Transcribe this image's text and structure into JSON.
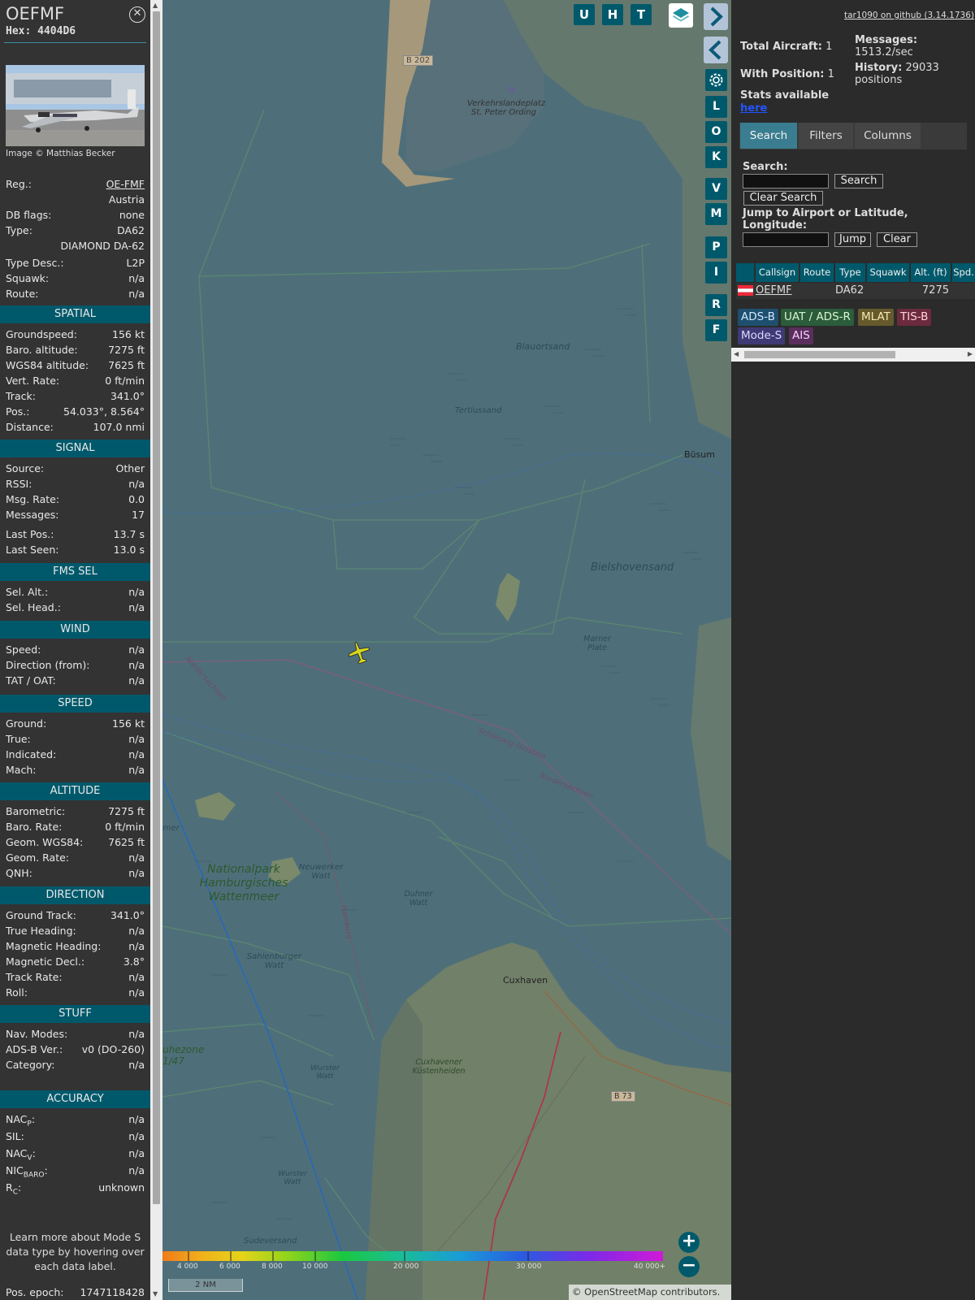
{
  "info_panel": {
    "callsign": "OEFMF",
    "hex_label": "Hex:",
    "hex": "4404D6",
    "close_icon": "close-circle-icon",
    "photo_caption": "Image © Matthias Becker",
    "rows": [
      {
        "k": "Reg.:",
        "v": "OE-FMF",
        "link": true
      },
      {
        "k": "",
        "v": "Austria"
      },
      {
        "k": "DB flags:",
        "v": "none"
      },
      {
        "k": "Type:",
        "v": "DA62"
      },
      {
        "k": "",
        "v": "DIAMOND DA-62"
      },
      {
        "k": "Type Desc.:",
        "v": "L2P"
      },
      {
        "k": "Squawk:",
        "v": "n/a"
      },
      {
        "k": "Route:",
        "v": "n/a"
      }
    ],
    "sections": [
      {
        "title": "SPATIAL",
        "rows": [
          {
            "k": "Groundspeed:",
            "v": "156 kt"
          },
          {
            "k": "Baro. altitude:",
            "v": "7275 ft"
          },
          {
            "k": "WGS84 altitude:",
            "v": "7625 ft"
          },
          {
            "k": "Vert. Rate:",
            "v": "0 ft/min"
          },
          {
            "k": "Track:",
            "v": "341.0°"
          },
          {
            "k": "Pos.:",
            "v": "54.033°, 8.564°"
          },
          {
            "k": "Distance:",
            "v": "107.0 nmi"
          }
        ]
      },
      {
        "title": "SIGNAL",
        "rows": [
          {
            "k": "Source:",
            "v": "Other"
          },
          {
            "k": "RSSI:",
            "v": "n/a"
          },
          {
            "k": "Msg. Rate:",
            "v": "0.0"
          },
          {
            "k": "Messages:",
            "v": "17"
          },
          {
            "k": "Last Pos.:",
            "v": "13.7 s"
          },
          {
            "k": "Last Seen:",
            "v": "13.0 s"
          }
        ]
      },
      {
        "title": "FMS SEL",
        "rows": [
          {
            "k": "Sel. Alt.:",
            "v": "n/a"
          },
          {
            "k": "Sel. Head.:",
            "v": "n/a"
          }
        ]
      },
      {
        "title": "WIND",
        "rows": [
          {
            "k": "Speed:",
            "v": "n/a"
          },
          {
            "k": "Direction (from):",
            "v": "n/a"
          },
          {
            "k": "TAT / OAT:",
            "v": "n/a"
          }
        ]
      },
      {
        "title": "SPEED",
        "rows": [
          {
            "k": "Ground:",
            "v": "156 kt"
          },
          {
            "k": "True:",
            "v": "n/a"
          },
          {
            "k": "Indicated:",
            "v": "n/a"
          },
          {
            "k": "Mach:",
            "v": "n/a"
          }
        ]
      },
      {
        "title": "ALTITUDE",
        "rows": [
          {
            "k": "Barometric:",
            "v": "7275 ft"
          },
          {
            "k": "Baro. Rate:",
            "v": "0 ft/min"
          },
          {
            "k": "Geom. WGS84:",
            "v": "7625 ft"
          },
          {
            "k": "Geom. Rate:",
            "v": "n/a"
          },
          {
            "k": "QNH:",
            "v": "n/a"
          }
        ]
      },
      {
        "title": "DIRECTION",
        "rows": [
          {
            "k": "Ground Track:",
            "v": "341.0°"
          },
          {
            "k": "True Heading:",
            "v": "n/a"
          },
          {
            "k": "Magnetic Heading:",
            "v": "n/a"
          },
          {
            "k": "Magnetic Decl.:",
            "v": "3.8°"
          },
          {
            "k": "Track Rate:",
            "v": "n/a"
          },
          {
            "k": "Roll:",
            "v": "n/a"
          }
        ]
      },
      {
        "title": "STUFF",
        "rows": [
          {
            "k": "Nav. Modes:",
            "v": "n/a"
          },
          {
            "k": "ADS-B Ver.:",
            "v": "v0 (DO-260)"
          },
          {
            "k": "Category:",
            "v": "n/a"
          }
        ]
      },
      {
        "title": "ACCURACY",
        "rows": [
          {
            "k": "NAC",
            "sub": "P",
            "v": "n/a"
          },
          {
            "k": "SIL:",
            "v": "n/a"
          },
          {
            "k": "NAC",
            "sub": "V",
            "v": "n/a"
          },
          {
            "k": "NIC",
            "sub": "BARO",
            "v": "n/a"
          },
          {
            "k": "R",
            "sub": "C",
            "v": "unknown"
          }
        ]
      }
    ],
    "learn_more": "Learn more about Mode S data type by hovering over each data label.",
    "pos_epoch_label": "Pos. epoch:",
    "pos_epoch": "1747118428"
  },
  "map": {
    "toolbar": [
      "U",
      "H",
      "T"
    ],
    "side_buttons": [
      "L",
      "O",
      "K",
      "V",
      "M",
      "P",
      "I",
      "R",
      "F"
    ],
    "icons": {
      "layers": "layers-icon",
      "next": "chevron-right-icon",
      "prev": "chevron-left-icon",
      "settings": "gear-icon",
      "expand": "expand-horizontal-icon",
      "zoom_in": "plus-icon",
      "zoom_out": "minus-icon",
      "aircraft": "airplane-icon"
    },
    "labels": [
      {
        "t": "B 202"
      },
      {
        "t": "Verkehrslandeplatz St. Peter Ording"
      },
      {
        "t": "Blauortsand"
      },
      {
        "t": "Tertiussand"
      },
      {
        "t": "Büsum"
      },
      {
        "t": "Bielshovensand"
      },
      {
        "t": "Marner Plate"
      },
      {
        "t": "Niedersachsen"
      },
      {
        "t": "Schleswig-Holstein"
      },
      {
        "t": "Niedersachsen"
      },
      {
        "t": "Nationalpark Hamburgisches Wattenmeer"
      },
      {
        "t": "Neuwerker Watt"
      },
      {
        "t": "Duhner Watt"
      },
      {
        "t": "Hamburg"
      },
      {
        "t": "Cuxhaven"
      },
      {
        "t": "Sahlenburger Watt"
      },
      {
        "t": "Cuxhavener Küstenheiden"
      },
      {
        "t": "Wurster Watt"
      },
      {
        "t": "Wurster Watt"
      },
      {
        "t": "Sudeversand"
      },
      {
        "t": "B 73"
      },
      {
        "t": "rner"
      },
      {
        "t": "uhezone 1/47"
      }
    ],
    "color_ticks": [
      "4 000",
      "6 000",
      "8 000",
      "10 000",
      "20 000",
      "30 000",
      "40 000+"
    ],
    "scale": "2 NM",
    "attribution": "© OpenStreetMap contributors."
  },
  "right_panel": {
    "github_link": "tar1090 on github (3.14.1736)",
    "total_aircraft_label": "Total Aircraft:",
    "total_aircraft": "1",
    "with_position_label": "With Position:",
    "with_position": "1",
    "stats_label": "Stats available",
    "stats_link": "here",
    "messages_label": "Messages:",
    "messages_rate": "1513.2/sec",
    "history_label": "History:",
    "history_value": "29033 positions",
    "tabs": [
      "Search",
      "Filters",
      "Columns"
    ],
    "search_label": "Search:",
    "search_button": "Search",
    "clear_search_button": "Clear Search",
    "jump_label": "Jump to Airport or Latitude, Longitude:",
    "jump_button": "Jump",
    "clear_button": "Clear",
    "table_headers": [
      "Callsign",
      "Route",
      "Type",
      "Squawk",
      "Alt. (ft)",
      "Spd."
    ],
    "table_rows": [
      {
        "callsign": "OEFMF",
        "route": "",
        "type": "DA62",
        "squawk": "",
        "alt": "7275",
        "spd": ""
      }
    ],
    "sources": [
      {
        "label": "ADS-B",
        "bg": "#1e4f6e",
        "fg": "#cfe8ff"
      },
      {
        "label": "UAT / ADS-R",
        "bg": "#2b5c3c",
        "fg": "#d8f5d0"
      },
      {
        "label": "MLAT",
        "bg": "#665a2c",
        "fg": "#f5eab0"
      },
      {
        "label": "TIS-B",
        "bg": "#6b2a3e",
        "fg": "#ffd4dc"
      },
      {
        "label": "Mode-S",
        "bg": "#3f3a74",
        "fg": "#dcd8ff"
      },
      {
        "label": "AIS",
        "bg": "#5a2e5c",
        "fg": "#f7d3ff"
      }
    ]
  }
}
